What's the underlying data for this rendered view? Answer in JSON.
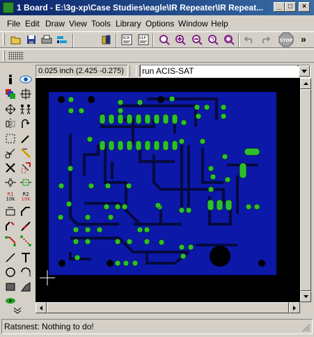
{
  "window": {
    "title": "1 Board - E:\\3g-xp\\Case Studies\\eagle\\IR Repeater\\IR Repeat...",
    "minimize": "_",
    "maximize": "□",
    "close": "×"
  },
  "menu": [
    "File",
    "Edit",
    "Draw",
    "View",
    "Tools",
    "Library",
    "Options",
    "Window",
    "Help"
  ],
  "toolbar": {
    "icons": [
      "open-icon",
      "save-icon",
      "print-icon",
      "cam-icon",
      "library-icon",
      "script-icon",
      "ulp-icon",
      "zoom-fit-icon",
      "zoom-in-icon",
      "zoom-out-icon",
      "redraw-icon",
      "zoom-select-icon",
      "undo-icon",
      "redo-icon",
      "stop-icon"
    ],
    "stop_label": "STOP",
    "overflow": "»"
  },
  "command": {
    "coordinates": "0.025 inch (2.425 -0.275)",
    "input_value": "run ACIS-SAT"
  },
  "palette": {
    "icons": [
      "info-icon",
      "show-icon",
      "display-layers-icon",
      "mark-icon",
      "move-icon",
      "copy-icon",
      "mirror-icon",
      "rotate-icon",
      "group-icon",
      "change-icon",
      "cut-icon",
      "paste-icon",
      "delete-icon",
      "add-icon",
      "pinswap-icon",
      "replace-icon",
      "name-icon",
      "value-icon",
      "smash-icon",
      "miter-icon",
      "split-icon",
      "optimize-icon",
      "route-icon",
      "ripup-icon",
      "wire-icon",
      "text-icon",
      "circle-icon",
      "arc-icon",
      "rect-icon",
      "polygon-icon",
      "via-icon",
      "more-icon"
    ],
    "labels": {
      "r1": "R1",
      "r2": "R2",
      "v10k": "10k"
    }
  },
  "colors": {
    "board": "#0b18a8",
    "pad": "#2bc02b",
    "trace": "#050a40",
    "background": "#000000",
    "titlebar": "#0a246a"
  },
  "status": {
    "message": "Ratsnest: Nothing to do!"
  }
}
